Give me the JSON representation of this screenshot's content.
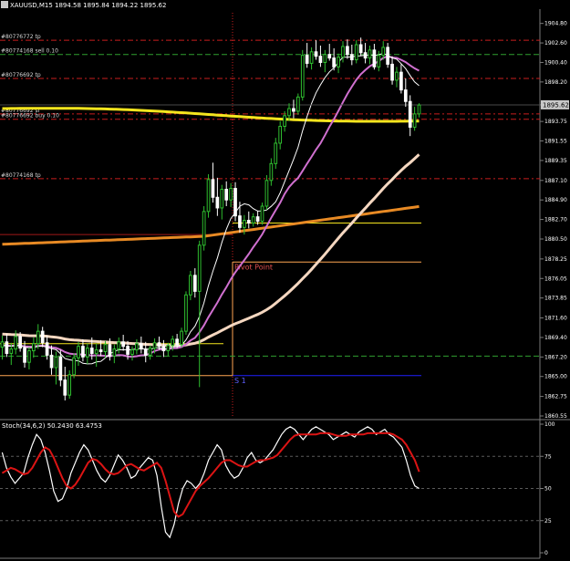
{
  "window": {
    "title": "XAUUSD,M15",
    "ohlc": "1894.58 1895.84 1894.22 1895.62",
    "last_price": "1895.62"
  },
  "colors": {
    "background": "#000000",
    "bull_candle": "#2fbf2f",
    "bear_candle": "#ffffff",
    "ma_white": "#ffffff",
    "ma_violet": "#d070d0",
    "ma_yellow": "#f5e51e",
    "ma_orange": "#e88a24",
    "ma_cream": "#f5d7c0",
    "level_red": "#c81e1e",
    "level_green": "#2f9f2f",
    "pivot": "#ffa552",
    "s1": "#2020ff",
    "stoch_main": "#ffffff",
    "stoch_signal": "#dc1414"
  },
  "order_lines": [
    {
      "label": "#80776772 tp",
      "price": 1902.9
    },
    {
      "label": "#80774168 sell 0.10",
      "price": 1901.3
    },
    {
      "label": "#80776692 tp",
      "price": 1898.6
    },
    {
      "label": "#80776692 sl",
      "price": 1894.6
    },
    {
      "label": "#80776692 buy 0.10",
      "price": 1894.0
    },
    {
      "label": "#80774168 tp",
      "price": 1887.3
    }
  ],
  "levels": [
    {
      "label": "Pivot Point",
      "price": 1877.9
    },
    {
      "label": "S 1",
      "price": 1865.1
    }
  ],
  "chart_data": [
    {
      "type": "candlestick",
      "title": "XAUUSD,M15",
      "ylim": [
        1860.55,
        1906.0
      ],
      "y_ticks": [
        "1904.80",
        "1902.60",
        "1900.40",
        "1898.20",
        "1895.62",
        "1893.75",
        "1891.55",
        "1889.35",
        "1887.10",
        "1884.90",
        "1882.70",
        "1880.50",
        "1878.25",
        "1876.05",
        "1873.85",
        "1871.60",
        "1869.40",
        "1867.20",
        "1865.00",
        "1862.75",
        "1860.55"
      ],
      "candles": [
        [
          1868.3,
          1869.6,
          1866.9,
          1868.9
        ],
        [
          1868.9,
          1869.8,
          1867.2,
          1867.6
        ],
        [
          1867.6,
          1868.8,
          1866.3,
          1868.1
        ],
        [
          1868.1,
          1870.2,
          1867.5,
          1869.5
        ],
        [
          1869.5,
          1870.0,
          1867.8,
          1868.2
        ],
        [
          1868.2,
          1869.0,
          1866.0,
          1866.6
        ],
        [
          1866.6,
          1868.3,
          1865.8,
          1867.9
        ],
        [
          1867.9,
          1869.4,
          1867.1,
          1868.7
        ],
        [
          1868.7,
          1870.9,
          1868.1,
          1870.1
        ],
        [
          1870.1,
          1870.6,
          1868.3,
          1868.8
        ],
        [
          1868.8,
          1869.6,
          1866.9,
          1867.4
        ],
        [
          1867.4,
          1868.5,
          1865.2,
          1866.0
        ],
        [
          1866.0,
          1867.8,
          1864.1,
          1867.2
        ],
        [
          1867.2,
          1868.0,
          1863.9,
          1864.6
        ],
        [
          1864.6,
          1866.1,
          1862.3,
          1862.9
        ],
        [
          1862.9,
          1865.7,
          1862.5,
          1865.2
        ],
        [
          1865.2,
          1867.6,
          1864.8,
          1867.1
        ],
        [
          1867.1,
          1868.9,
          1866.2,
          1868.4
        ],
        [
          1868.4,
          1869.2,
          1866.7,
          1867.2
        ],
        [
          1867.2,
          1868.7,
          1866.4,
          1868.2
        ],
        [
          1868.2,
          1869.4,
          1866.9,
          1867.6
        ],
        [
          1867.6,
          1868.7,
          1866.1,
          1868.0
        ],
        [
          1868.0,
          1869.1,
          1867.3,
          1867.8
        ],
        [
          1867.8,
          1869.0,
          1867.1,
          1868.6
        ],
        [
          1868.6,
          1869.3,
          1866.8,
          1867.3
        ],
        [
          1867.3,
          1868.6,
          1866.5,
          1868.1
        ],
        [
          1868.1,
          1869.4,
          1867.6,
          1868.9
        ],
        [
          1868.9,
          1869.7,
          1867.9,
          1868.4
        ],
        [
          1868.4,
          1869.0,
          1866.9,
          1867.5
        ],
        [
          1867.5,
          1868.4,
          1866.8,
          1868.0
        ],
        [
          1868.0,
          1869.2,
          1867.5,
          1868.7
        ],
        [
          1868.7,
          1869.5,
          1867.6,
          1868.1
        ],
        [
          1868.1,
          1868.9,
          1866.6,
          1867.4
        ],
        [
          1867.4,
          1868.5,
          1866.9,
          1868.2
        ],
        [
          1868.2,
          1869.3,
          1867.6,
          1868.8
        ],
        [
          1868.8,
          1869.5,
          1868.0,
          1868.4
        ],
        [
          1868.4,
          1869.1,
          1867.2,
          1867.9
        ],
        [
          1867.9,
          1868.8,
          1867.3,
          1868.5
        ],
        [
          1868.5,
          1869.6,
          1867.9,
          1869.2
        ],
        [
          1869.2,
          1869.8,
          1868.2,
          1868.6
        ],
        [
          1868.6,
          1870.5,
          1868.3,
          1870.1
        ],
        [
          1870.1,
          1874.6,
          1869.7,
          1874.2
        ],
        [
          1874.2,
          1876.9,
          1873.6,
          1876.4
        ],
        [
          1876.4,
          1877.2,
          1873.9,
          1874.6
        ],
        [
          1874.6,
          1880.3,
          1863.8,
          1879.8
        ],
        [
          1879.8,
          1884.2,
          1879.2,
          1883.6
        ],
        [
          1883.6,
          1887.8,
          1882.9,
          1887.2
        ],
        [
          1887.2,
          1889.1,
          1884.6,
          1885.2
        ],
        [
          1885.2,
          1887.4,
          1883.1,
          1884.0
        ],
        [
          1884.0,
          1886.6,
          1882.7,
          1886.1
        ],
        [
          1886.1,
          1887.0,
          1884.2,
          1884.9
        ],
        [
          1884.9,
          1886.8,
          1884.1,
          1886.2
        ],
        [
          1886.2,
          1886.9,
          1882.5,
          1883.1
        ],
        [
          1883.1,
          1884.7,
          1881.2,
          1881.8
        ],
        [
          1881.8,
          1883.2,
          1881.0,
          1882.6
        ],
        [
          1882.6,
          1883.6,
          1881.7,
          1882.3
        ],
        [
          1882.3,
          1883.4,
          1881.9,
          1883.0
        ],
        [
          1883.0,
          1883.7,
          1882.1,
          1882.5
        ],
        [
          1882.5,
          1884.6,
          1882.1,
          1884.2
        ],
        [
          1884.2,
          1887.7,
          1883.8,
          1887.1
        ],
        [
          1887.1,
          1889.6,
          1886.5,
          1889.0
        ],
        [
          1889.0,
          1891.9,
          1888.4,
          1891.3
        ],
        [
          1891.3,
          1893.8,
          1890.6,
          1893.2
        ],
        [
          1893.2,
          1894.9,
          1892.6,
          1894.4
        ],
        [
          1894.4,
          1895.8,
          1893.8,
          1895.2
        ],
        [
          1895.2,
          1896.2,
          1894.1,
          1894.9
        ],
        [
          1894.9,
          1896.9,
          1894.5,
          1896.5
        ],
        [
          1896.5,
          1901.8,
          1896.1,
          1901.2
        ],
        [
          1901.2,
          1902.6,
          1899.8,
          1900.3
        ],
        [
          1900.3,
          1902.1,
          1899.6,
          1901.6
        ],
        [
          1901.6,
          1902.9,
          1900.7,
          1901.1
        ],
        [
          1901.1,
          1902.3,
          1899.9,
          1900.4
        ],
        [
          1900.4,
          1901.8,
          1899.3,
          1901.3
        ],
        [
          1901.3,
          1902.5,
          1900.6,
          1900.9
        ],
        [
          1900.9,
          1902.0,
          1899.5,
          1899.9
        ],
        [
          1899.9,
          1901.4,
          1899.2,
          1901.0
        ],
        [
          1901.0,
          1902.8,
          1900.4,
          1902.2
        ],
        [
          1902.2,
          1903.0,
          1900.8,
          1901.3
        ],
        [
          1901.3,
          1902.4,
          1900.1,
          1900.7
        ],
        [
          1900.7,
          1902.9,
          1900.3,
          1902.4
        ],
        [
          1902.4,
          1903.2,
          1901.1,
          1901.5
        ],
        [
          1901.5,
          1902.6,
          1900.3,
          1900.9
        ],
        [
          1900.9,
          1902.3,
          1900.2,
          1901.8
        ],
        [
          1901.8,
          1902.5,
          1899.6,
          1899.9
        ],
        [
          1899.9,
          1901.7,
          1899.4,
          1901.2
        ],
        [
          1901.2,
          1902.8,
          1900.7,
          1902.1
        ],
        [
          1902.1,
          1902.6,
          1899.8,
          1900.2
        ],
        [
          1900.2,
          1901.1,
          1897.9,
          1898.4
        ],
        [
          1898.4,
          1899.9,
          1897.6,
          1899.3
        ],
        [
          1899.3,
          1900.2,
          1896.9,
          1897.3
        ],
        [
          1897.3,
          1898.6,
          1895.4,
          1896.0
        ],
        [
          1896.0,
          1896.7,
          1892.1,
          1893.1
        ],
        [
          1893.1,
          1895.4,
          1892.7,
          1894.6
        ],
        [
          1894.6,
          1895.8,
          1894.2,
          1895.6
        ]
      ]
    },
    {
      "type": "line",
      "title": "Stoch(34,6,2) 50.2430 63.4753",
      "ylim": [
        0,
        100
      ],
      "y_ticks": [
        "100",
        "75",
        "50",
        "25",
        "0"
      ],
      "series": [
        {
          "name": "Stoch(34,6,2)",
          "values": [
            78,
            66,
            59,
            54,
            58,
            62,
            74,
            84,
            92,
            88,
            78,
            64,
            48,
            40,
            42,
            50,
            62,
            70,
            78,
            84,
            80,
            72,
            64,
            58,
            55,
            60,
            68,
            76,
            72,
            66,
            58,
            60,
            66,
            70,
            74,
            72,
            60,
            36,
            16,
            12,
            22,
            38,
            50,
            56,
            54,
            50,
            54,
            62,
            72,
            78,
            84,
            80,
            68,
            62,
            58,
            60,
            66,
            74,
            78,
            72,
            70,
            72,
            76,
            80,
            86,
            92,
            96,
            98,
            96,
            92,
            88,
            92,
            96,
            98,
            96,
            94,
            92,
            88,
            90,
            92,
            94,
            92,
            90,
            94,
            96,
            98,
            96,
            92,
            94,
            96,
            92,
            90,
            86,
            82,
            72,
            60,
            52,
            50
          ]
        },
        {
          "name": "Signal",
          "values": [
            62,
            64,
            66,
            65,
            63,
            61,
            62,
            66,
            72,
            78,
            82,
            80,
            74,
            66,
            58,
            52,
            50,
            53,
            58,
            64,
            70,
            73,
            72,
            69,
            65,
            62,
            61,
            62,
            65,
            68,
            69,
            67,
            65,
            64,
            66,
            68,
            70,
            66,
            56,
            44,
            32,
            28,
            30,
            36,
            42,
            48,
            52,
            55,
            58,
            62,
            66,
            70,
            72,
            72,
            70,
            68,
            67,
            67,
            69,
            71,
            72,
            72,
            73,
            74,
            76,
            80,
            84,
            88,
            91,
            92,
            92,
            92,
            92,
            92,
            93,
            93,
            93,
            92,
            91,
            91,
            91,
            92,
            92,
            92,
            92,
            93,
            93,
            93,
            93,
            93,
            93,
            92,
            90,
            88,
            84,
            78,
            72,
            63
          ]
        }
      ]
    }
  ]
}
